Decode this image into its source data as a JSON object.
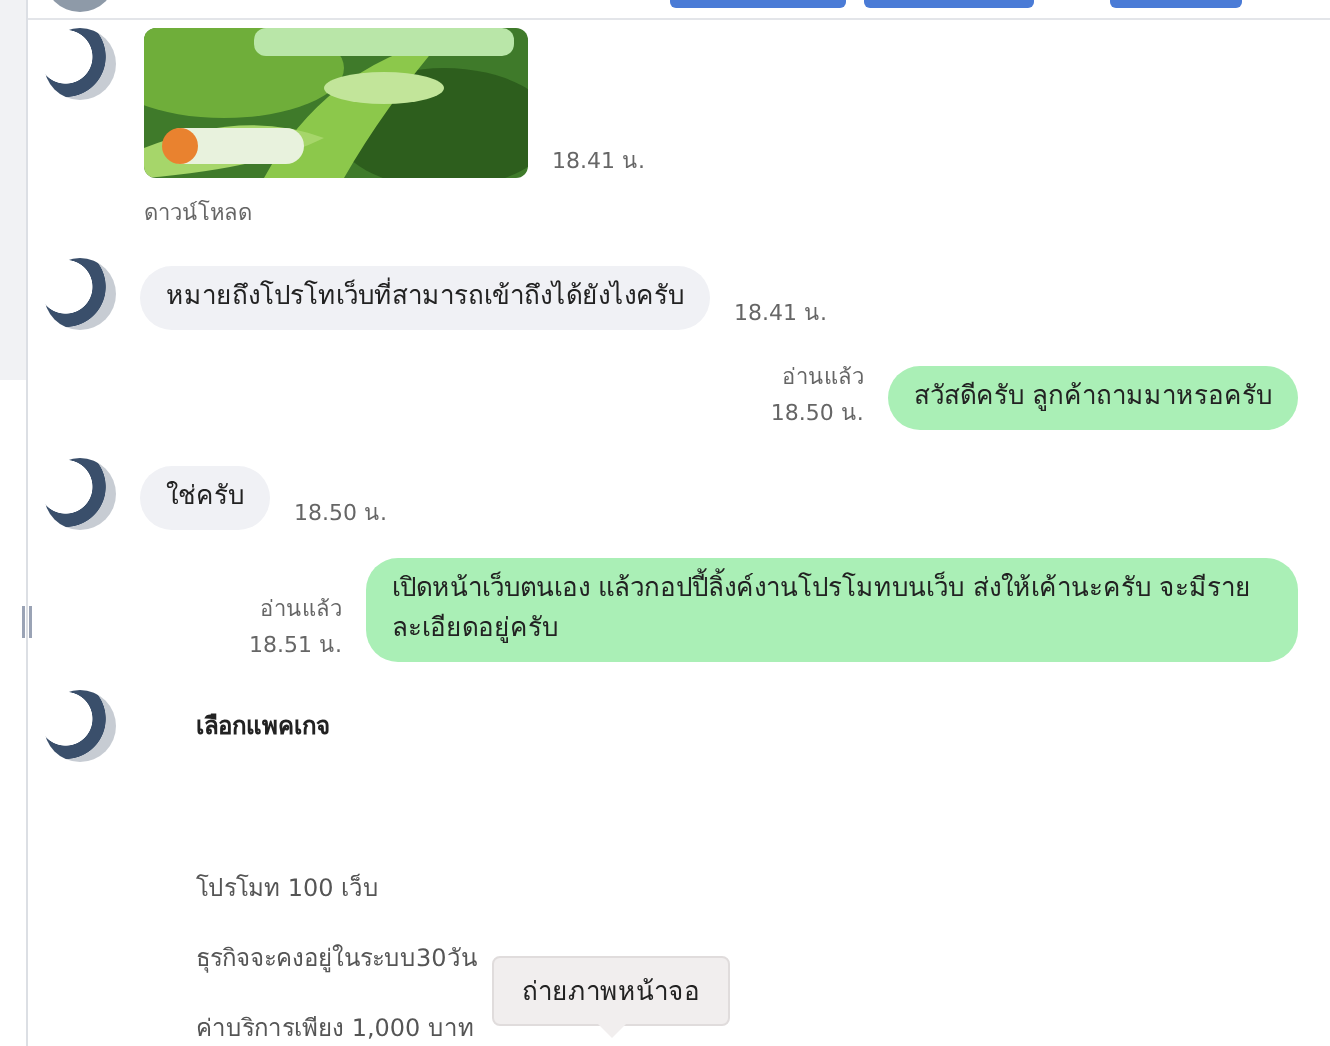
{
  "messages": [
    {
      "time": "18.41 น.",
      "caption": "ดาวน์โหลด"
    },
    {
      "kind": "incoming",
      "text": "หมายถึงโปรโทเว็บที่สามารถเข้าถึงได้ยังไงครับ",
      "time": "18.41 น."
    },
    {
      "kind": "outgoing",
      "read": "อ่านแล้ว",
      "text": "สวัสดีครับ ลูกค้าถามมาหรอครับ",
      "time": "18.50 น."
    },
    {
      "kind": "incoming",
      "text": "ใช่ครับ",
      "time": "18.50 น."
    },
    {
      "kind": "outgoing",
      "read": "อ่านแล้ว",
      "text": "เปิดหน้าเว็บตนเอง แล้วกอปปี้ลิ้งค์งานโปรโมทบนเว็บ ส่งให้เค้านะครับ จะมีรายละเอียดอยู่ครับ",
      "time": "18.51 น."
    },
    {
      "kind": "document",
      "lines": [
        {
          "text": "เลือกแพคเกจ",
          "bold": true
        },
        {
          "text": "โปรโมท 100 เว็บ",
          "bold": false
        },
        {
          "text": "ธุรกิจจะคงอยู่ในระบบ30วัน",
          "bold": false
        },
        {
          "text": "ค่าบริการเพียง 1,000 บาท",
          "bold": false
        }
      ]
    }
  ],
  "tooltip": {
    "text": "ถ่ายภาพหน้าจอ"
  }
}
